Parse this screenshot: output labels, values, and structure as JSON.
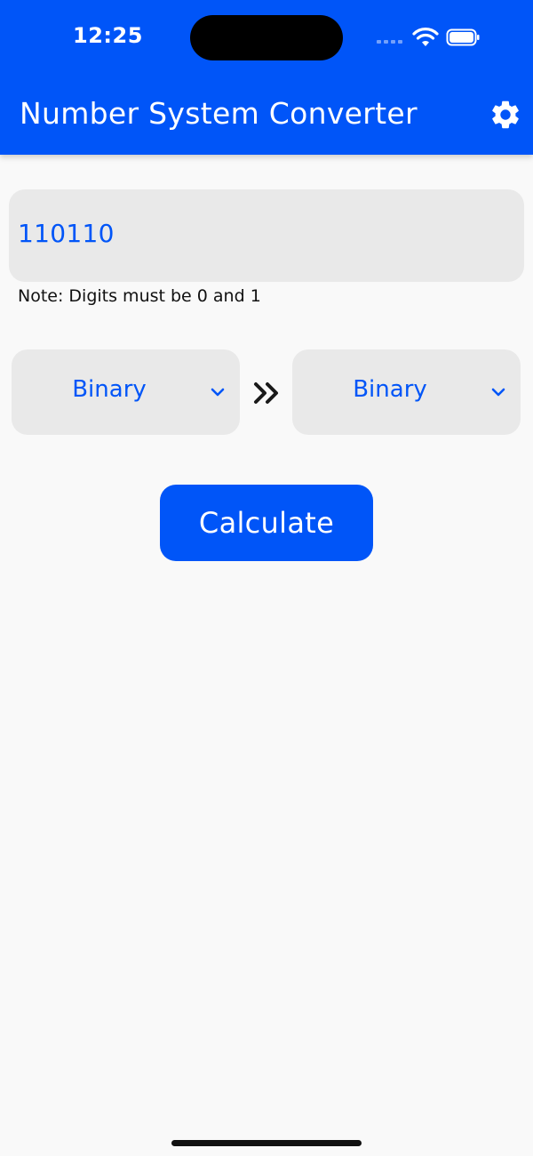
{
  "status_bar": {
    "time": "12:25"
  },
  "header": {
    "title": "Number System Converter",
    "settings_icon": "gear-icon"
  },
  "input": {
    "value": "110110",
    "note": "Note: Digits must be 0 and 1"
  },
  "conversion": {
    "from": "Binary",
    "to": "Binary",
    "arrows_icon": "double-chevron-right-icon"
  },
  "actions": {
    "calculate_label": "Calculate"
  },
  "colors": {
    "primary": "#0055f8",
    "field_bg": "#e9e9e9",
    "page_bg": "#f9f9f9"
  }
}
